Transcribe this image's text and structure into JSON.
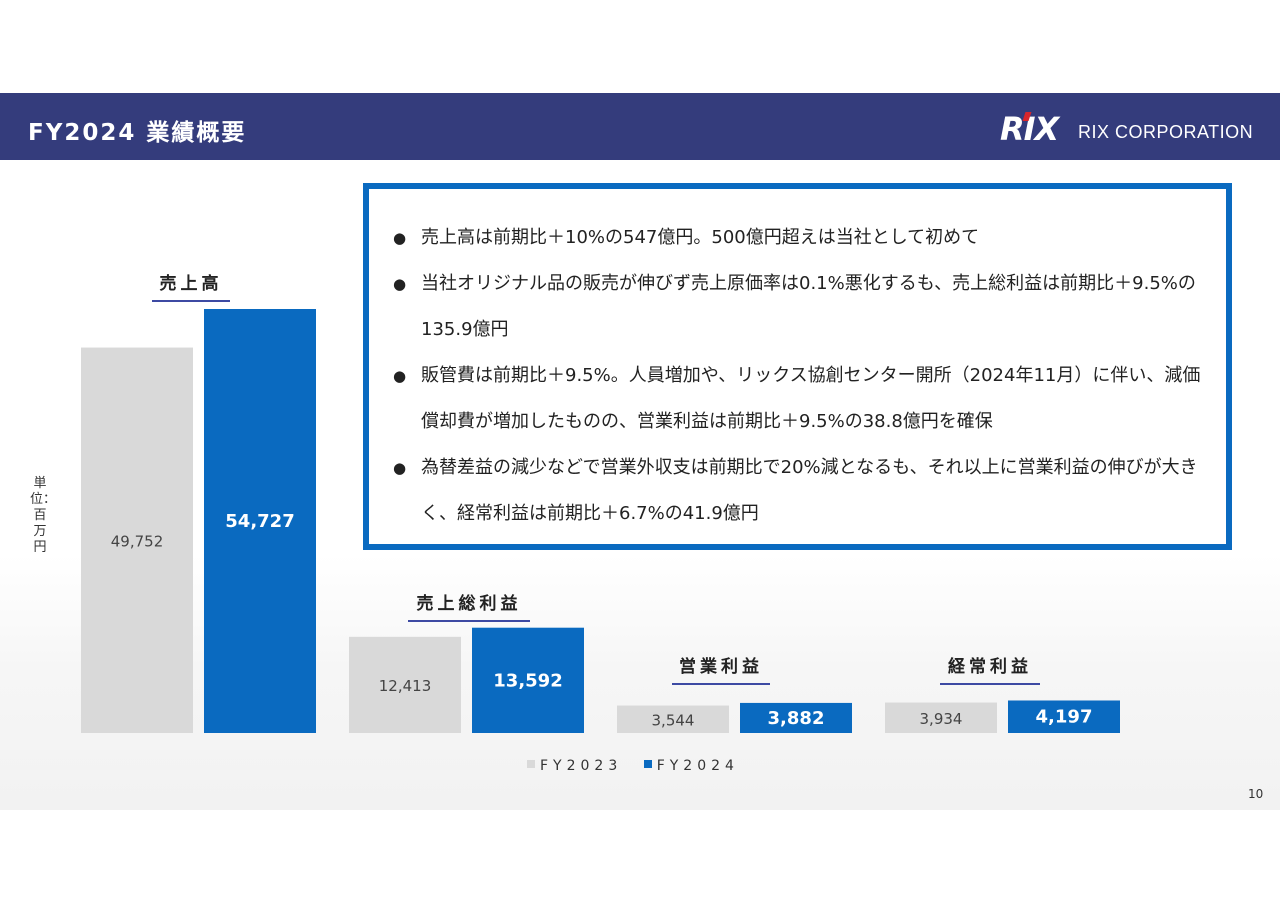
{
  "header": {
    "title": "FY2024 業績概要",
    "logo_mark": "RIX",
    "logo_text": "RIX CORPORATION"
  },
  "summary": {
    "bullets": [
      "売上高は前期比＋10%の547億円。500億円超えは当社として初めて",
      "当社オリジナル品の販売が伸びず売上原価率は0.1%悪化するも、売上総利益は前期比＋9.5%の135.9億円",
      "販管費は前期比＋9.5%。人員増加や、リックス協創センター開所（2024年11月）に伴い、減価償却費が増加したものの、営業利益は前期比＋9.5%の38.8億円を確保",
      "為替差益の減少などで営業外収支は前期比で20%減となるも、それ以上に営業利益の伸びが大きく、経常利益は前期比＋6.7%の41.9億円"
    ]
  },
  "unit_label": "単位：百万円",
  "colors": {
    "header_bg": "#343c7c",
    "fy2023": "#d9d9d9",
    "fy2024": "#0a6ac0",
    "accent_red": "#d7262d"
  },
  "chart_data": {
    "type": "bar",
    "groups": [
      {
        "name": "売上高",
        "categories": [
          "FY2023",
          "FY2024"
        ],
        "values": [
          49752,
          54727
        ],
        "labels": [
          "49,752",
          "54,727"
        ]
      },
      {
        "name": "売上総利益",
        "categories": [
          "FY2023",
          "FY2024"
        ],
        "values": [
          12413,
          13592
        ],
        "labels": [
          "12,413",
          "13,592"
        ]
      },
      {
        "name": "営業利益",
        "categories": [
          "FY2023",
          "FY2024"
        ],
        "values": [
          3544,
          3882
        ],
        "labels": [
          "3,544",
          "3,882"
        ]
      },
      {
        "name": "経常利益",
        "categories": [
          "FY2023",
          "FY2024"
        ],
        "values": [
          3934,
          4197
        ],
        "labels": [
          "3,934",
          "4,197"
        ]
      }
    ],
    "legend": [
      "FY2023",
      "FY2024"
    ],
    "legend_position": "bottom"
  },
  "page_number": "10"
}
